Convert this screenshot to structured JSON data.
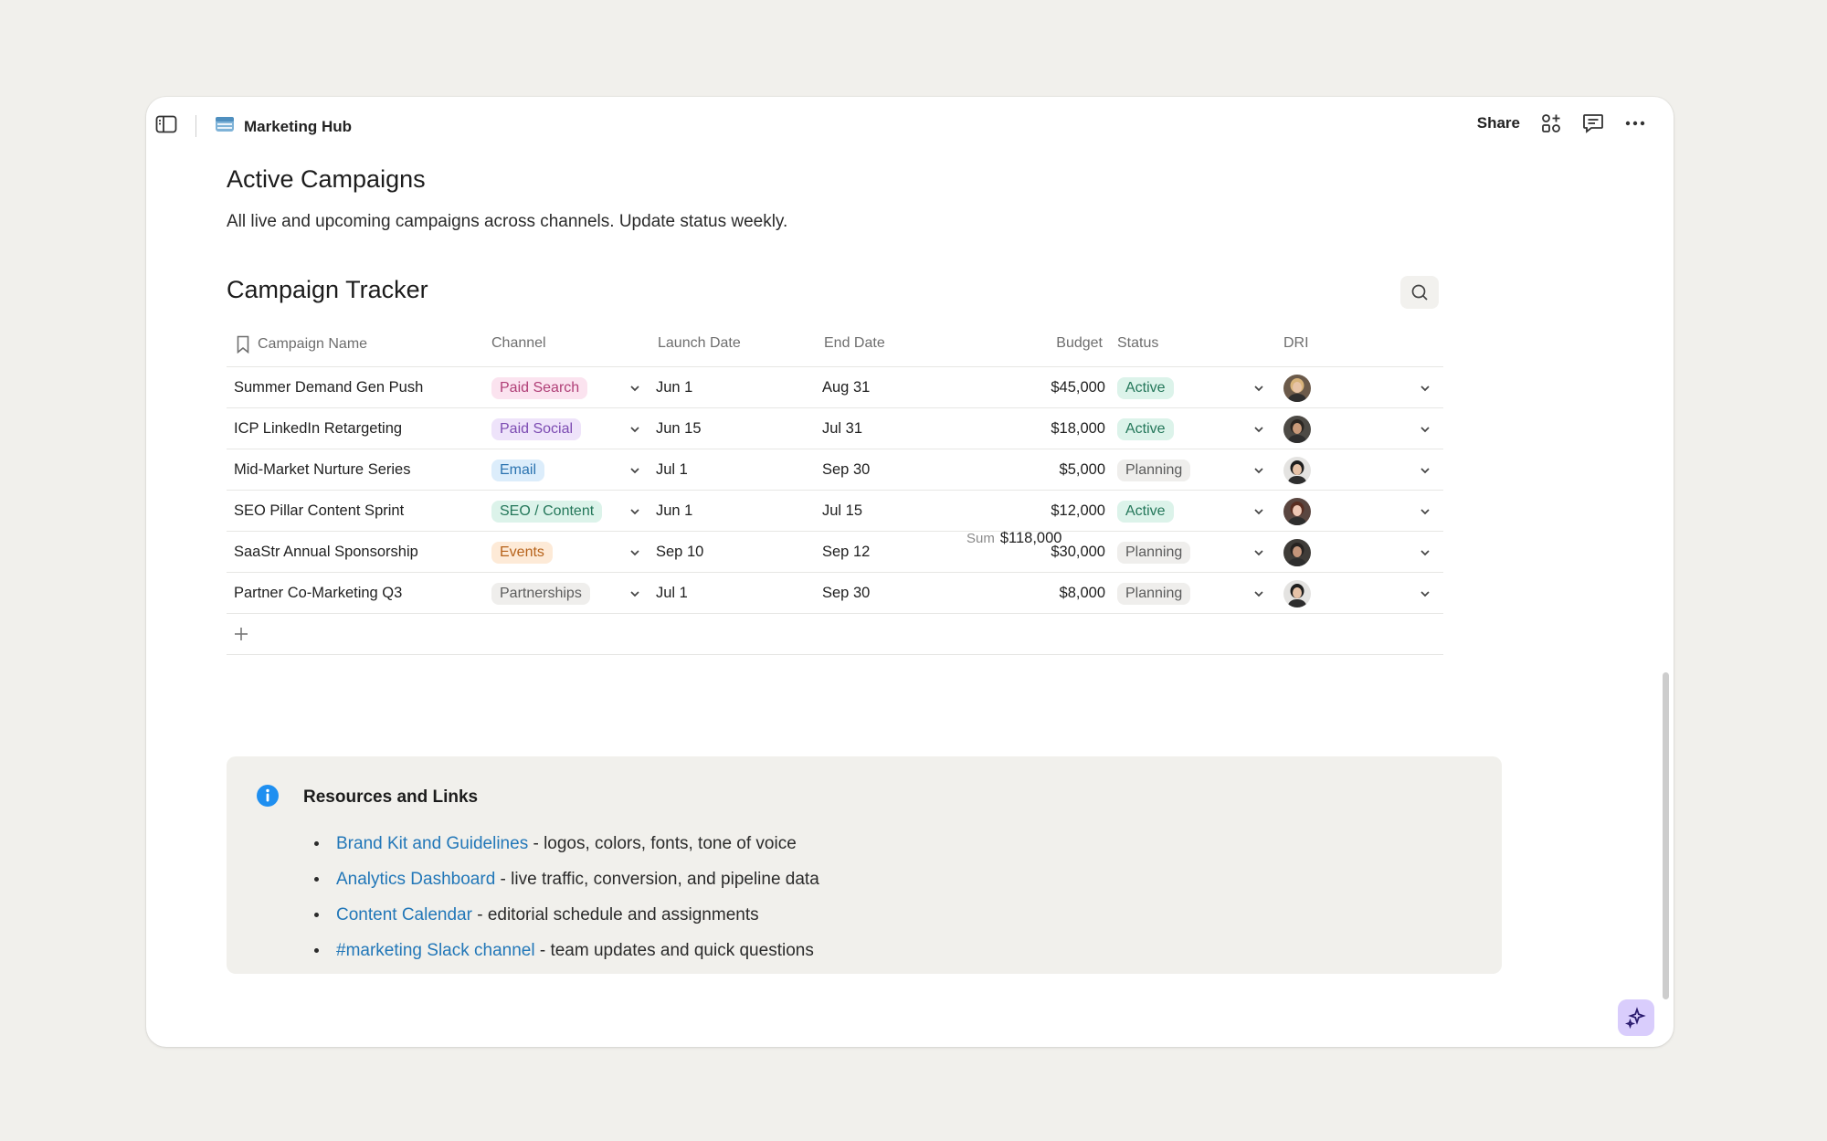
{
  "breadcrumb": {
    "label": "Marketing Hub"
  },
  "toolbar": {
    "share_label": "Share"
  },
  "page": {
    "title": "Active Campaigns",
    "description": "All live and upcoming campaigns across channels. Update status weekly."
  },
  "database": {
    "title": "Campaign Tracker",
    "columns": {
      "name": "Campaign Name",
      "channel": "Channel",
      "launch": "Launch Date",
      "end": "End Date",
      "budget": "Budget",
      "status": "Status",
      "dri": "DRI"
    },
    "rows": [
      {
        "name": "Summer Demand Gen Push",
        "channel": "Paid Search",
        "launch": "Jun 1",
        "end": "Aug 31",
        "budget": "$45,000",
        "status": "Active"
      },
      {
        "name": "ICP LinkedIn Retargeting",
        "channel": "Paid Social",
        "launch": "Jun 15",
        "end": "Jul 31",
        "budget": "$18,000",
        "status": "Active"
      },
      {
        "name": "Mid-Market Nurture Series",
        "channel": "Email",
        "launch": "Jul 1",
        "end": "Sep 30",
        "budget": "$5,000",
        "status": "Planning"
      },
      {
        "name": "SEO Pillar Content Sprint",
        "channel": "SEO / Content",
        "launch": "Jun 1",
        "end": "Jul 15",
        "budget": "$12,000",
        "status": "Active"
      },
      {
        "name": "SaaStr Annual Sponsorship",
        "channel": "Events",
        "launch": "Sep 10",
        "end": "Sep 12",
        "budget": "$30,000",
        "status": "Planning"
      },
      {
        "name": "Partner Co-Marketing Q3",
        "channel": "Partnerships",
        "launch": "Jul 1",
        "end": "Sep 30",
        "budget": "$8,000",
        "status": "Planning"
      }
    ],
    "sum_label": "Sum",
    "sum_value": "$118,000"
  },
  "colors": {
    "channel": {
      "Paid Search": {
        "bg": "#fbe3ef",
        "fg": "#b03f77"
      },
      "Paid Social": {
        "bg": "#eee3fa",
        "fg": "#7c4bb2"
      },
      "Email": {
        "bg": "#dcedfb",
        "fg": "#2b73b0"
      },
      "SEO / Content": {
        "bg": "#dcf3ea",
        "fg": "#24775a"
      },
      "Events": {
        "bg": "#fdead7",
        "fg": "#b7631b"
      },
      "Partnerships": {
        "bg": "#efeeec",
        "fg": "#5c5c5c"
      }
    },
    "status": {
      "Active": {
        "bg": "#dcf3ea",
        "fg": "#24775a"
      },
      "Planning": {
        "bg": "#efeeec",
        "fg": "#5c5c5c"
      }
    },
    "link": "#2277b8",
    "info_icon": "#1f8ff0",
    "ai_button": "#d9cdfc"
  },
  "callout": {
    "title": "Resources and Links",
    "items": [
      {
        "link": "Brand Kit and Guidelines",
        "text": " - logos, colors, fonts, tone of voice"
      },
      {
        "link": "Analytics Dashboard",
        "text": " - live traffic, conversion, and pipeline data"
      },
      {
        "link": "Content Calendar",
        "text": " - editorial schedule and assignments"
      },
      {
        "link": "#marketing Slack channel",
        "text": " - team updates and quick questions"
      }
    ]
  }
}
